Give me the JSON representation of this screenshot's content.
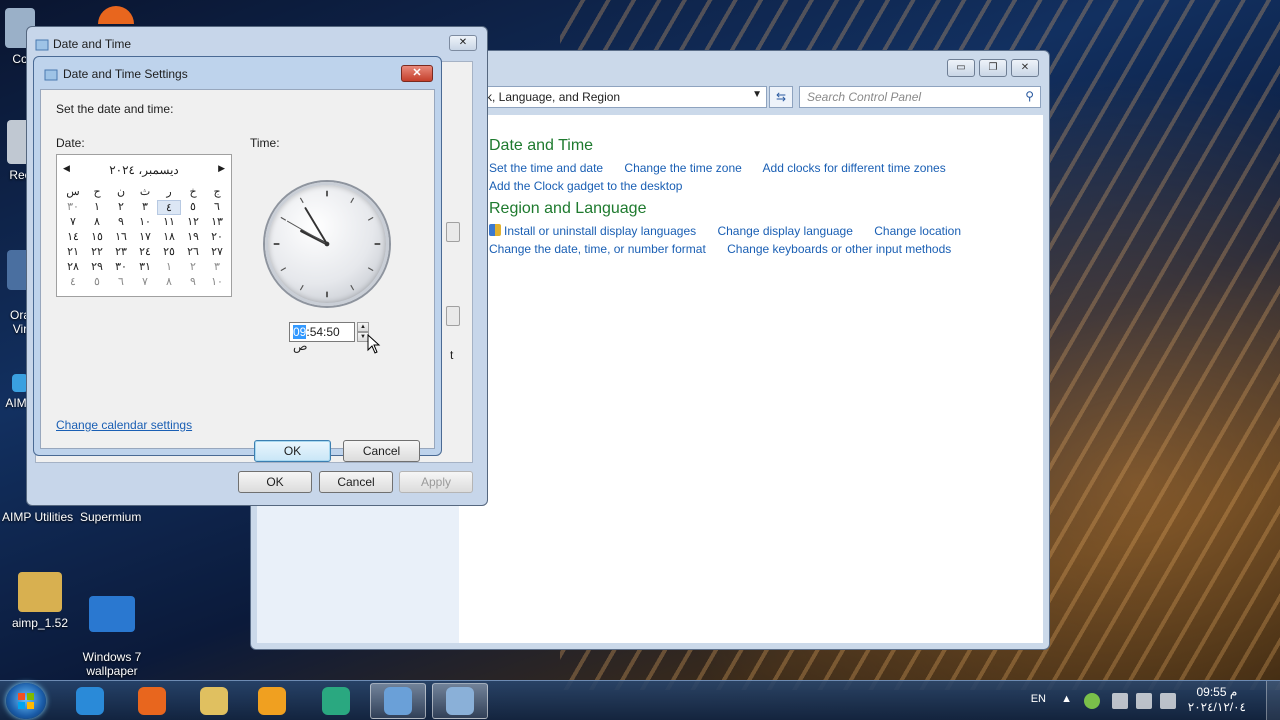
{
  "desktop": {
    "icons": [
      {
        "label": "Co",
        "color": "#9ab0c8"
      },
      {
        "label": "Rec",
        "color": "#c0c8d2"
      },
      {
        "label": "Ora\nVir",
        "color": "#4a6fa0"
      },
      {
        "label": "AIMP",
        "color": "#3aa0e0"
      },
      {
        "label": "aimp_1.52",
        "color": "#d8b050"
      },
      {
        "label": "Windows 7\nwallpaper",
        "color": "#2a78d0"
      }
    ],
    "labels": [
      "AIMP Utilities",
      "Supermium"
    ]
  },
  "control_panel": {
    "address": "k, Language, and Region",
    "search_placeholder": "Search Control Panel",
    "window_buttons": {
      "minimize": "▭",
      "maximize": "❐",
      "close": "✕"
    },
    "sections": [
      {
        "title": "Date and Time",
        "icon": "clock-calendar-icon",
        "links": [
          "Set the time and date",
          "Change the time zone",
          "Add clocks for different time zones",
          "Add the Clock gadget to the desktop"
        ]
      },
      {
        "title": "Region and Language",
        "icon": "globe-icon",
        "links": [
          "Install or uninstall display languages",
          "Change display language",
          "Change location",
          "Change the date, time, or number format",
          "Change keyboards or other input methods"
        ]
      }
    ]
  },
  "date_time_window": {
    "title": "Date and Time",
    "close": "✕",
    "fragment_text": "t",
    "ok": "OK",
    "cancel": "Cancel",
    "apply": "Apply"
  },
  "settings_dialog": {
    "title": "Date and Time Settings",
    "close": "✕",
    "instruction": "Set the date and time:",
    "date_label": "Date:",
    "time_label": "Time:",
    "calendar": {
      "month_title": "دیسمبر، ٢٠٢٤",
      "prev": "◀",
      "next": "▶",
      "weekdays": [
        "ج",
        "خ",
        "ر",
        "ث",
        "ن",
        "ح",
        "س"
      ],
      "weeks": [
        [
          "٦",
          "٥",
          "٤",
          "٣",
          "٢",
          "١",
          "٣٠"
        ],
        [
          "١٣",
          "١٢",
          "١١",
          "١٠",
          "٩",
          "٨",
          "٧"
        ],
        [
          "٢٠",
          "١٩",
          "١٨",
          "١٧",
          "١٦",
          "١٥",
          "١٤"
        ],
        [
          "٢٧",
          "٢٦",
          "٢٥",
          "٢٤",
          "٢٣",
          "٢٢",
          "٢١"
        ],
        [
          "٣",
          "٢",
          "١",
          "٣١",
          "٣٠",
          "٢٩",
          "٢٨"
        ],
        [
          "١٠",
          "٩",
          "٨",
          "٧",
          "٦",
          "٥",
          "٤"
        ]
      ],
      "selected_day": "٤"
    },
    "clock": {
      "hour": 9,
      "minute": 54,
      "second": 50
    },
    "time_value_selected": "09",
    "time_value_rest": ":54:50 ص",
    "calendar_link": "Change calendar settings",
    "ok": "OK",
    "cancel": "Cancel"
  },
  "taskbar": {
    "items": [
      {
        "name": "internet-explorer-icon",
        "color": "#2a8ad8"
      },
      {
        "name": "firefox-icon",
        "color": "#e8661e"
      },
      {
        "name": "file-explorer-icon",
        "color": "#e0c060"
      },
      {
        "name": "media-player-icon",
        "color": "#f0a020"
      },
      {
        "name": "supermium-icon",
        "color": "#2aa880"
      },
      {
        "name": "control-panel-icon",
        "color": "#6aa0d8"
      },
      {
        "name": "date-time-icon",
        "color": "#8ab0d8"
      }
    ],
    "language": "EN",
    "tray_arrow": "▲",
    "time": "09:55 م",
    "date": "٢٠٢٤/١٢/٠٤"
  }
}
